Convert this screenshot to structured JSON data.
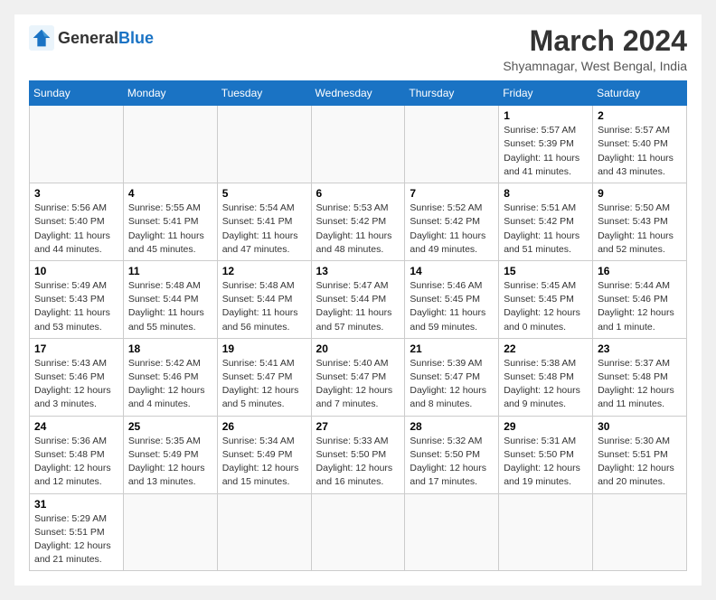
{
  "logo": {
    "text_general": "General",
    "text_blue": "Blue"
  },
  "header": {
    "title": "March 2024",
    "subtitle": "Shyamnagar, West Bengal, India"
  },
  "weekdays": [
    "Sunday",
    "Monday",
    "Tuesday",
    "Wednesday",
    "Thursday",
    "Friday",
    "Saturday"
  ],
  "weeks": [
    [
      {
        "day": "",
        "info": ""
      },
      {
        "day": "",
        "info": ""
      },
      {
        "day": "",
        "info": ""
      },
      {
        "day": "",
        "info": ""
      },
      {
        "day": "",
        "info": ""
      },
      {
        "day": "1",
        "info": "Sunrise: 5:57 AM\nSunset: 5:39 PM\nDaylight: 11 hours\nand 41 minutes."
      },
      {
        "day": "2",
        "info": "Sunrise: 5:57 AM\nSunset: 5:40 PM\nDaylight: 11 hours\nand 43 minutes."
      }
    ],
    [
      {
        "day": "3",
        "info": "Sunrise: 5:56 AM\nSunset: 5:40 PM\nDaylight: 11 hours\nand 44 minutes."
      },
      {
        "day": "4",
        "info": "Sunrise: 5:55 AM\nSunset: 5:41 PM\nDaylight: 11 hours\nand 45 minutes."
      },
      {
        "day": "5",
        "info": "Sunrise: 5:54 AM\nSunset: 5:41 PM\nDaylight: 11 hours\nand 47 minutes."
      },
      {
        "day": "6",
        "info": "Sunrise: 5:53 AM\nSunset: 5:42 PM\nDaylight: 11 hours\nand 48 minutes."
      },
      {
        "day": "7",
        "info": "Sunrise: 5:52 AM\nSunset: 5:42 PM\nDaylight: 11 hours\nand 49 minutes."
      },
      {
        "day": "8",
        "info": "Sunrise: 5:51 AM\nSunset: 5:42 PM\nDaylight: 11 hours\nand 51 minutes."
      },
      {
        "day": "9",
        "info": "Sunrise: 5:50 AM\nSunset: 5:43 PM\nDaylight: 11 hours\nand 52 minutes."
      }
    ],
    [
      {
        "day": "10",
        "info": "Sunrise: 5:49 AM\nSunset: 5:43 PM\nDaylight: 11 hours\nand 53 minutes."
      },
      {
        "day": "11",
        "info": "Sunrise: 5:48 AM\nSunset: 5:44 PM\nDaylight: 11 hours\nand 55 minutes."
      },
      {
        "day": "12",
        "info": "Sunrise: 5:48 AM\nSunset: 5:44 PM\nDaylight: 11 hours\nand 56 minutes."
      },
      {
        "day": "13",
        "info": "Sunrise: 5:47 AM\nSunset: 5:44 PM\nDaylight: 11 hours\nand 57 minutes."
      },
      {
        "day": "14",
        "info": "Sunrise: 5:46 AM\nSunset: 5:45 PM\nDaylight: 11 hours\nand 59 minutes."
      },
      {
        "day": "15",
        "info": "Sunrise: 5:45 AM\nSunset: 5:45 PM\nDaylight: 12 hours\nand 0 minutes."
      },
      {
        "day": "16",
        "info": "Sunrise: 5:44 AM\nSunset: 5:46 PM\nDaylight: 12 hours\nand 1 minute."
      }
    ],
    [
      {
        "day": "17",
        "info": "Sunrise: 5:43 AM\nSunset: 5:46 PM\nDaylight: 12 hours\nand 3 minutes."
      },
      {
        "day": "18",
        "info": "Sunrise: 5:42 AM\nSunset: 5:46 PM\nDaylight: 12 hours\nand 4 minutes."
      },
      {
        "day": "19",
        "info": "Sunrise: 5:41 AM\nSunset: 5:47 PM\nDaylight: 12 hours\nand 5 minutes."
      },
      {
        "day": "20",
        "info": "Sunrise: 5:40 AM\nSunset: 5:47 PM\nDaylight: 12 hours\nand 7 minutes."
      },
      {
        "day": "21",
        "info": "Sunrise: 5:39 AM\nSunset: 5:47 PM\nDaylight: 12 hours\nand 8 minutes."
      },
      {
        "day": "22",
        "info": "Sunrise: 5:38 AM\nSunset: 5:48 PM\nDaylight: 12 hours\nand 9 minutes."
      },
      {
        "day": "23",
        "info": "Sunrise: 5:37 AM\nSunset: 5:48 PM\nDaylight: 12 hours\nand 11 minutes."
      }
    ],
    [
      {
        "day": "24",
        "info": "Sunrise: 5:36 AM\nSunset: 5:48 PM\nDaylight: 12 hours\nand 12 minutes."
      },
      {
        "day": "25",
        "info": "Sunrise: 5:35 AM\nSunset: 5:49 PM\nDaylight: 12 hours\nand 13 minutes."
      },
      {
        "day": "26",
        "info": "Sunrise: 5:34 AM\nSunset: 5:49 PM\nDaylight: 12 hours\nand 15 minutes."
      },
      {
        "day": "27",
        "info": "Sunrise: 5:33 AM\nSunset: 5:50 PM\nDaylight: 12 hours\nand 16 minutes."
      },
      {
        "day": "28",
        "info": "Sunrise: 5:32 AM\nSunset: 5:50 PM\nDaylight: 12 hours\nand 17 minutes."
      },
      {
        "day": "29",
        "info": "Sunrise: 5:31 AM\nSunset: 5:50 PM\nDaylight: 12 hours\nand 19 minutes."
      },
      {
        "day": "30",
        "info": "Sunrise: 5:30 AM\nSunset: 5:51 PM\nDaylight: 12 hours\nand 20 minutes."
      }
    ],
    [
      {
        "day": "31",
        "info": "Sunrise: 5:29 AM\nSunset: 5:51 PM\nDaylight: 12 hours\nand 21 minutes."
      },
      {
        "day": "",
        "info": ""
      },
      {
        "day": "",
        "info": ""
      },
      {
        "day": "",
        "info": ""
      },
      {
        "day": "",
        "info": ""
      },
      {
        "day": "",
        "info": ""
      },
      {
        "day": "",
        "info": ""
      }
    ]
  ]
}
